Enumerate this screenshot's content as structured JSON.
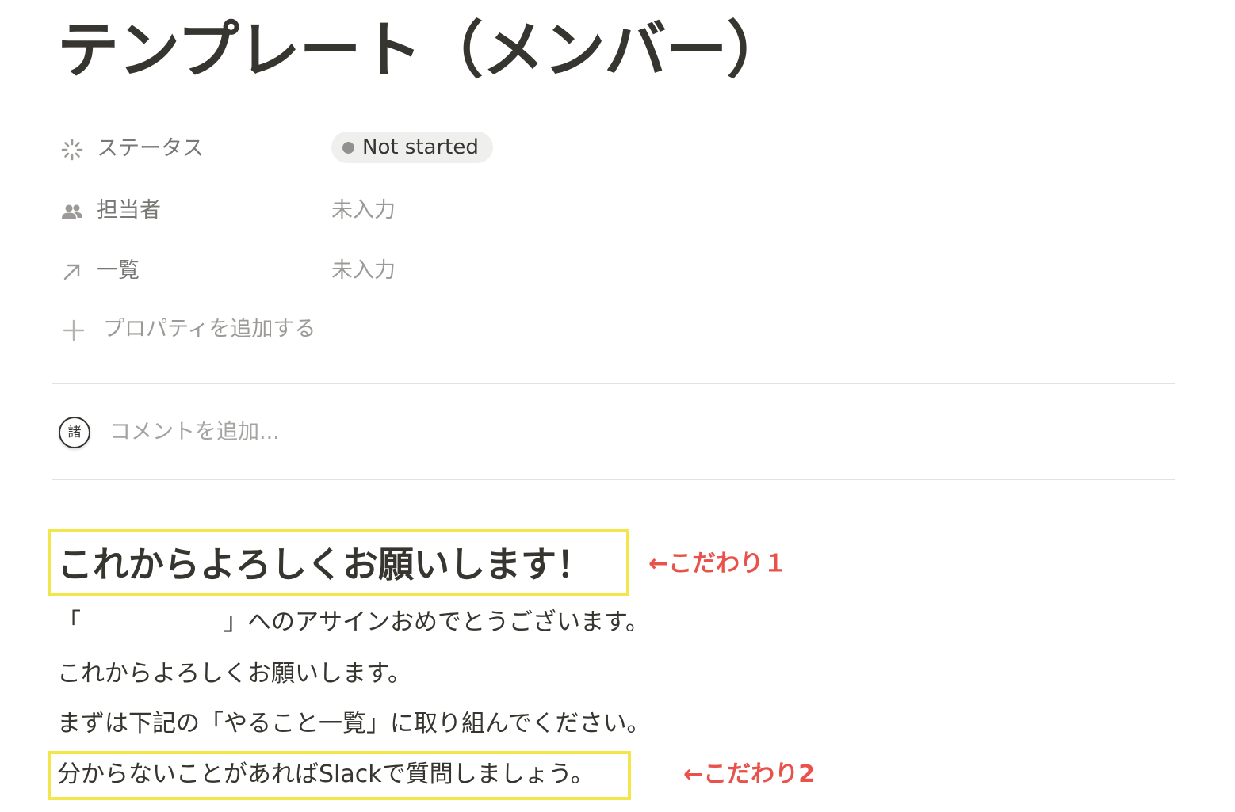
{
  "page": {
    "title": "テンプレート（メンバー）"
  },
  "properties": {
    "status": {
      "label": "ステータス",
      "value": "Not started",
      "icon": "status-loading-icon"
    },
    "assignee": {
      "label": "担当者",
      "value": "未入力",
      "icon": "people-icon"
    },
    "relation": {
      "label": "一覧",
      "value": "未入力",
      "icon": "arrow-up-right-icon"
    },
    "add_property": "プロパティを追加する"
  },
  "comment": {
    "avatar_text": "諸",
    "placeholder": "コメントを追加..."
  },
  "content": {
    "heading": "これからよろしくお願いします！",
    "heading_annotation": "←こだわり１",
    "line1": "「　　　　　　」へのアサインおめでとうございます。",
    "line2": "これからよろしくお願いします。",
    "line3": "まずは下記の「やること一覧」に取り組んでください。",
    "line4": "分からないことがあればSlackで質問しましょう。",
    "line4_annotation": "←こだわり2"
  },
  "colors": {
    "text": "#37352f",
    "muted": "#9b9a97",
    "highlight_box": "#f2e64a",
    "annotation": "#e8524a",
    "status_badge_bg": "#efefed"
  }
}
